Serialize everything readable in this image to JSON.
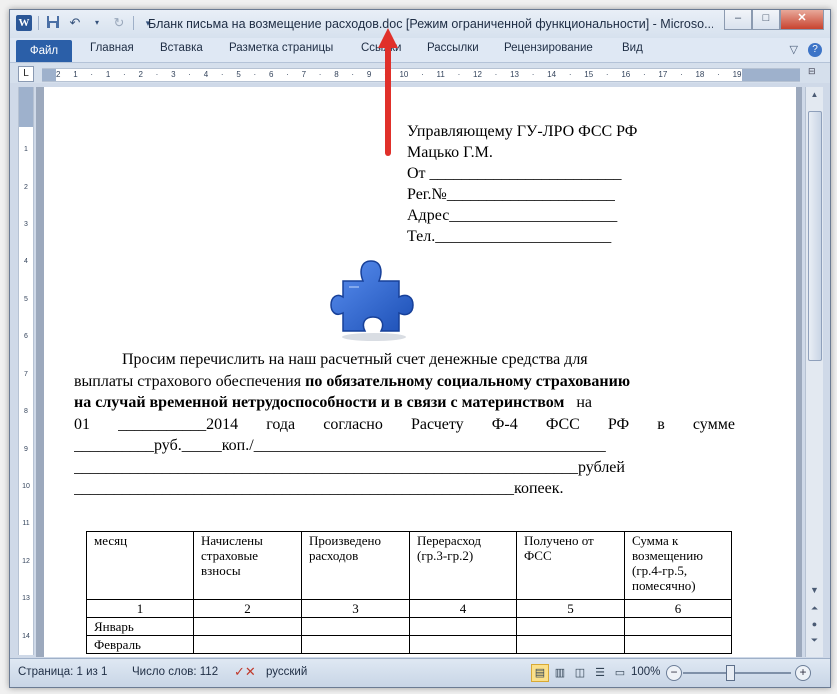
{
  "window": {
    "title": "Бланк письма на возмещение расходов.doc [Режим ограниченной функциональности]  -  Microso...",
    "app_icon_letter": "W",
    "qat": {
      "save_icon": "save-icon",
      "undo_icon": "undo-icon",
      "redo_icon": "redo-icon",
      "customize_icon": "dropdown-icon"
    },
    "buttons": {
      "minimize": "–",
      "maximize": "□",
      "close": "✕"
    }
  },
  "ribbon": {
    "file_tab": "Файл",
    "tabs": [
      "Главная",
      "Вставка",
      "Разметка страницы",
      "Ссылки",
      "Рассылки",
      "Рецензирование",
      "Вид"
    ]
  },
  "ruler": {
    "corner": "L",
    "numbers": [
      "2",
      "1",
      "",
      "1",
      "",
      "2",
      "",
      "3",
      "",
      "4",
      "",
      "5",
      "",
      "6",
      "",
      "7",
      "",
      "8",
      "",
      "9",
      "",
      "10",
      "",
      "11",
      "",
      "12",
      "",
      "13",
      "",
      "14",
      "",
      "15",
      "",
      "16",
      "",
      "17",
      "",
      "18",
      "",
      "19"
    ],
    "vnumbers": [
      "1",
      "2",
      "3",
      "4",
      "5",
      "6",
      "7",
      "8",
      "9",
      "10",
      "11",
      "12",
      "13",
      "14"
    ]
  },
  "document": {
    "address_lines": [
      "Управляющему ГУ-ЛРО ФСС РФ",
      "Мацько Г.М.",
      "От ________________________",
      "Рег.№_____________________",
      "Адрес_____________________",
      "Тел.______________________"
    ],
    "para_line1": "Просим  перечислить  на  наш  расчетный  счет  денежные  средства  для",
    "para_line2_plain": "выплаты страхового обеспечения ",
    "para_line2_bold": "по обязательному социальному страхованию",
    "para_line3_bold": "на случай временной нетрудоспособности и в связи с материнством",
    "para_line3_tail": "   на",
    "para_line4_parts": [
      "01",
      "___________2014",
      "года",
      "согласно",
      "Расчету",
      "Ф-4",
      "ФСС",
      "РФ",
      "в",
      "сумме"
    ],
    "para_line5": "__________руб._____коп./____________________________________________",
    "para_line6": "_______________________________________________________________рублей",
    "para_line7": "_______________________________________________________копеек."
  },
  "table": {
    "headers": [
      "месяц",
      "Начислены страховые взносы",
      "Произведено расходов",
      "Перерасход (гр.3-гр.2)",
      "Получено от ФСС",
      "Сумма к возмещению (гр.4-гр.5, помесячно)"
    ],
    "numbers": [
      "1",
      "2",
      "3",
      "4",
      "5",
      "6"
    ],
    "rows": [
      "Январь",
      "Февраль"
    ]
  },
  "status": {
    "page": "Страница: 1 из 1",
    "words": "Число слов: 112",
    "language": "русский",
    "zoom": "100%",
    "zoom_minus": "−",
    "zoom_plus": "+"
  },
  "colors": {
    "file_tab": "#2b5fa8",
    "arrow": "#e0302a",
    "puzzle": "#2f6ad0"
  }
}
